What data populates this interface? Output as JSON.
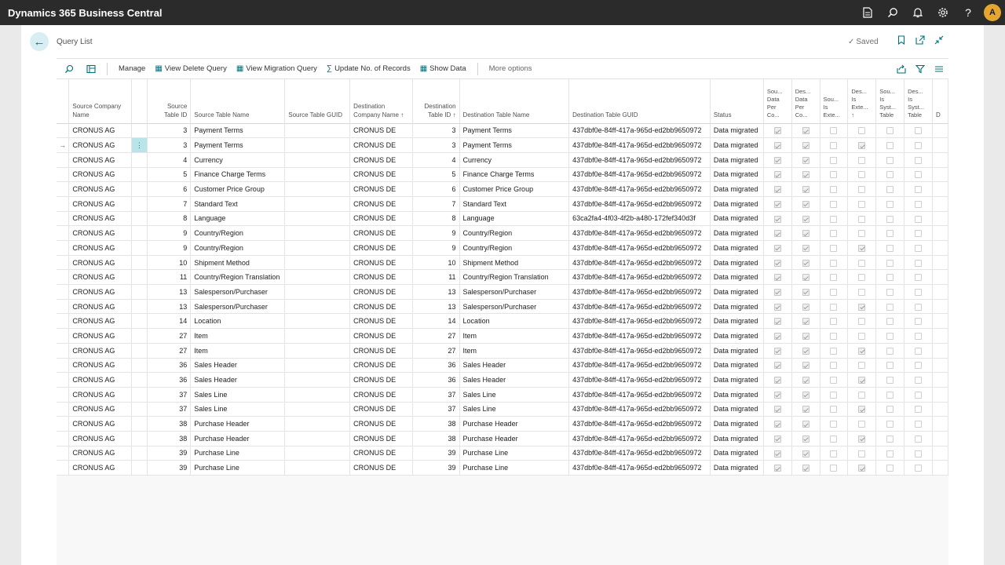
{
  "app": {
    "title": "Dynamics 365 Business Central",
    "user_initial": "A",
    "top_icons": [
      "document-icon",
      "search-icon",
      "bell-icon",
      "gear-icon",
      "help-icon"
    ]
  },
  "page": {
    "title": "Query List",
    "saved_label": "Saved"
  },
  "actions": {
    "manage": "Manage",
    "view_delete_query": "View Delete Query",
    "view_migration_query": "View Migration Query",
    "update_no_records": "Update No. of Records",
    "show_data": "Show Data",
    "more_options": "More options"
  },
  "columns": {
    "source_company": "Source Company Name",
    "source_table_id": "Source Table ID",
    "source_table_name": "Source Table Name",
    "source_table_guid": "Source Table GUID",
    "dest_company": "Destination Company Name ↑",
    "dest_table_id": "Destination Table ID ↑",
    "dest_table_name": "Destination Table Name",
    "dest_table_guid": "Destination Table GUID",
    "status": "Status",
    "b1": "Sou... Data Per Co...",
    "b2": "Des... Data Per Co...",
    "b3": "Sou... Is Exte...",
    "b4": "Des... Is Exte... ↑",
    "b5": "Sou... Is Syst... Table",
    "b6": "Des... Is Syst... Table",
    "last": "D"
  },
  "rows": [
    {
      "sc": "CRONUS AG",
      "sid": "3",
      "sn": "Payment Terms",
      "sg": "",
      "dc": "CRONUS DE",
      "did": "3",
      "dn": "Payment Terms",
      "dg": "437dbf0e-84ff-417a-965d-ed2bb9650972",
      "st": "Data migrated",
      "b": [
        true,
        true,
        false,
        false,
        false,
        false
      ]
    },
    {
      "sc": "CRONUS AG",
      "sid": "3",
      "sn": "Payment Terms",
      "sg": "",
      "dc": "CRONUS DE",
      "did": "3",
      "dn": "Payment Terms",
      "dg": "437dbf0e-84ff-417a-965d-ed2bb9650972",
      "st": "Data migrated",
      "b": [
        true,
        true,
        false,
        true,
        false,
        false
      ],
      "selected": true
    },
    {
      "sc": "CRONUS AG",
      "sid": "4",
      "sn": "Currency",
      "sg": "",
      "dc": "CRONUS DE",
      "did": "4",
      "dn": "Currency",
      "dg": "437dbf0e-84ff-417a-965d-ed2bb9650972",
      "st": "Data migrated",
      "b": [
        true,
        true,
        false,
        false,
        false,
        false
      ]
    },
    {
      "sc": "CRONUS AG",
      "sid": "5",
      "sn": "Finance Charge Terms",
      "sg": "",
      "dc": "CRONUS DE",
      "did": "5",
      "dn": "Finance Charge Terms",
      "dg": "437dbf0e-84ff-417a-965d-ed2bb9650972",
      "st": "Data migrated",
      "b": [
        true,
        true,
        false,
        false,
        false,
        false
      ]
    },
    {
      "sc": "CRONUS AG",
      "sid": "6",
      "sn": "Customer Price Group",
      "sg": "",
      "dc": "CRONUS DE",
      "did": "6",
      "dn": "Customer Price Group",
      "dg": "437dbf0e-84ff-417a-965d-ed2bb9650972",
      "st": "Data migrated",
      "b": [
        true,
        true,
        false,
        false,
        false,
        false
      ]
    },
    {
      "sc": "CRONUS AG",
      "sid": "7",
      "sn": "Standard Text",
      "sg": "",
      "dc": "CRONUS DE",
      "did": "7",
      "dn": "Standard Text",
      "dg": "437dbf0e-84ff-417a-965d-ed2bb9650972",
      "st": "Data migrated",
      "b": [
        true,
        true,
        false,
        false,
        false,
        false
      ]
    },
    {
      "sc": "CRONUS AG",
      "sid": "8",
      "sn": "Language",
      "sg": "",
      "dc": "CRONUS DE",
      "did": "8",
      "dn": "Language",
      "dg": "63ca2fa4-4f03-4f2b-a480-172fef340d3f",
      "st": "Data migrated",
      "b": [
        true,
        true,
        false,
        false,
        false,
        false
      ]
    },
    {
      "sc": "CRONUS AG",
      "sid": "9",
      "sn": "Country/Region",
      "sg": "",
      "dc": "CRONUS DE",
      "did": "9",
      "dn": "Country/Region",
      "dg": "437dbf0e-84ff-417a-965d-ed2bb9650972",
      "st": "Data migrated",
      "b": [
        true,
        true,
        false,
        false,
        false,
        false
      ]
    },
    {
      "sc": "CRONUS AG",
      "sid": "9",
      "sn": "Country/Region",
      "sg": "",
      "dc": "CRONUS DE",
      "did": "9",
      "dn": "Country/Region",
      "dg": "437dbf0e-84ff-417a-965d-ed2bb9650972",
      "st": "Data migrated",
      "b": [
        true,
        true,
        false,
        true,
        false,
        false
      ]
    },
    {
      "sc": "CRONUS AG",
      "sid": "10",
      "sn": "Shipment Method",
      "sg": "",
      "dc": "CRONUS DE",
      "did": "10",
      "dn": "Shipment Method",
      "dg": "437dbf0e-84ff-417a-965d-ed2bb9650972",
      "st": "Data migrated",
      "b": [
        true,
        true,
        false,
        false,
        false,
        false
      ]
    },
    {
      "sc": "CRONUS AG",
      "sid": "11",
      "sn": "Country/Region Translation",
      "sg": "",
      "dc": "CRONUS DE",
      "did": "11",
      "dn": "Country/Region Translation",
      "dg": "437dbf0e-84ff-417a-965d-ed2bb9650972",
      "st": "Data migrated",
      "b": [
        true,
        true,
        false,
        false,
        false,
        false
      ]
    },
    {
      "sc": "CRONUS AG",
      "sid": "13",
      "sn": "Salesperson/Purchaser",
      "sg": "",
      "dc": "CRONUS DE",
      "did": "13",
      "dn": "Salesperson/Purchaser",
      "dg": "437dbf0e-84ff-417a-965d-ed2bb9650972",
      "st": "Data migrated",
      "b": [
        true,
        true,
        false,
        false,
        false,
        false
      ]
    },
    {
      "sc": "CRONUS AG",
      "sid": "13",
      "sn": "Salesperson/Purchaser",
      "sg": "",
      "dc": "CRONUS DE",
      "did": "13",
      "dn": "Salesperson/Purchaser",
      "dg": "437dbf0e-84ff-417a-965d-ed2bb9650972",
      "st": "Data migrated",
      "b": [
        true,
        true,
        false,
        true,
        false,
        false
      ]
    },
    {
      "sc": "CRONUS AG",
      "sid": "14",
      "sn": "Location",
      "sg": "",
      "dc": "CRONUS DE",
      "did": "14",
      "dn": "Location",
      "dg": "437dbf0e-84ff-417a-965d-ed2bb9650972",
      "st": "Data migrated",
      "b": [
        true,
        true,
        false,
        false,
        false,
        false
      ]
    },
    {
      "sc": "CRONUS AG",
      "sid": "27",
      "sn": "Item",
      "sg": "",
      "dc": "CRONUS DE",
      "did": "27",
      "dn": "Item",
      "dg": "437dbf0e-84ff-417a-965d-ed2bb9650972",
      "st": "Data migrated",
      "b": [
        true,
        true,
        false,
        false,
        false,
        false
      ]
    },
    {
      "sc": "CRONUS AG",
      "sid": "27",
      "sn": "Item",
      "sg": "",
      "dc": "CRONUS DE",
      "did": "27",
      "dn": "Item",
      "dg": "437dbf0e-84ff-417a-965d-ed2bb9650972",
      "st": "Data migrated",
      "b": [
        true,
        true,
        false,
        true,
        false,
        false
      ]
    },
    {
      "sc": "CRONUS AG",
      "sid": "36",
      "sn": "Sales Header",
      "sg": "",
      "dc": "CRONUS DE",
      "did": "36",
      "dn": "Sales Header",
      "dg": "437dbf0e-84ff-417a-965d-ed2bb9650972",
      "st": "Data migrated",
      "b": [
        true,
        true,
        false,
        false,
        false,
        false
      ]
    },
    {
      "sc": "CRONUS AG",
      "sid": "36",
      "sn": "Sales Header",
      "sg": "",
      "dc": "CRONUS DE",
      "did": "36",
      "dn": "Sales Header",
      "dg": "437dbf0e-84ff-417a-965d-ed2bb9650972",
      "st": "Data migrated",
      "b": [
        true,
        true,
        false,
        true,
        false,
        false
      ]
    },
    {
      "sc": "CRONUS AG",
      "sid": "37",
      "sn": "Sales Line",
      "sg": "",
      "dc": "CRONUS DE",
      "did": "37",
      "dn": "Sales Line",
      "dg": "437dbf0e-84ff-417a-965d-ed2bb9650972",
      "st": "Data migrated",
      "b": [
        true,
        true,
        false,
        false,
        false,
        false
      ]
    },
    {
      "sc": "CRONUS AG",
      "sid": "37",
      "sn": "Sales Line",
      "sg": "",
      "dc": "CRONUS DE",
      "did": "37",
      "dn": "Sales Line",
      "dg": "437dbf0e-84ff-417a-965d-ed2bb9650972",
      "st": "Data migrated",
      "b": [
        true,
        true,
        false,
        true,
        false,
        false
      ]
    },
    {
      "sc": "CRONUS AG",
      "sid": "38",
      "sn": "Purchase Header",
      "sg": "",
      "dc": "CRONUS DE",
      "did": "38",
      "dn": "Purchase Header",
      "dg": "437dbf0e-84ff-417a-965d-ed2bb9650972",
      "st": "Data migrated",
      "b": [
        true,
        true,
        false,
        false,
        false,
        false
      ]
    },
    {
      "sc": "CRONUS AG",
      "sid": "38",
      "sn": "Purchase Header",
      "sg": "",
      "dc": "CRONUS DE",
      "did": "38",
      "dn": "Purchase Header",
      "dg": "437dbf0e-84ff-417a-965d-ed2bb9650972",
      "st": "Data migrated",
      "b": [
        true,
        true,
        false,
        true,
        false,
        false
      ]
    },
    {
      "sc": "CRONUS AG",
      "sid": "39",
      "sn": "Purchase Line",
      "sg": "",
      "dc": "CRONUS DE",
      "did": "39",
      "dn": "Purchase Line",
      "dg": "437dbf0e-84ff-417a-965d-ed2bb9650972",
      "st": "Data migrated",
      "b": [
        true,
        true,
        false,
        false,
        false,
        false
      ]
    },
    {
      "sc": "CRONUS AG",
      "sid": "39",
      "sn": "Purchase Line",
      "sg": "",
      "dc": "CRONUS DE",
      "did": "39",
      "dn": "Purchase Line",
      "dg": "437dbf0e-84ff-417a-965d-ed2bb9650972",
      "st": "Data migrated",
      "b": [
        true,
        true,
        false,
        true,
        false,
        false
      ]
    }
  ],
  "scrollbar": {
    "position": 0
  }
}
